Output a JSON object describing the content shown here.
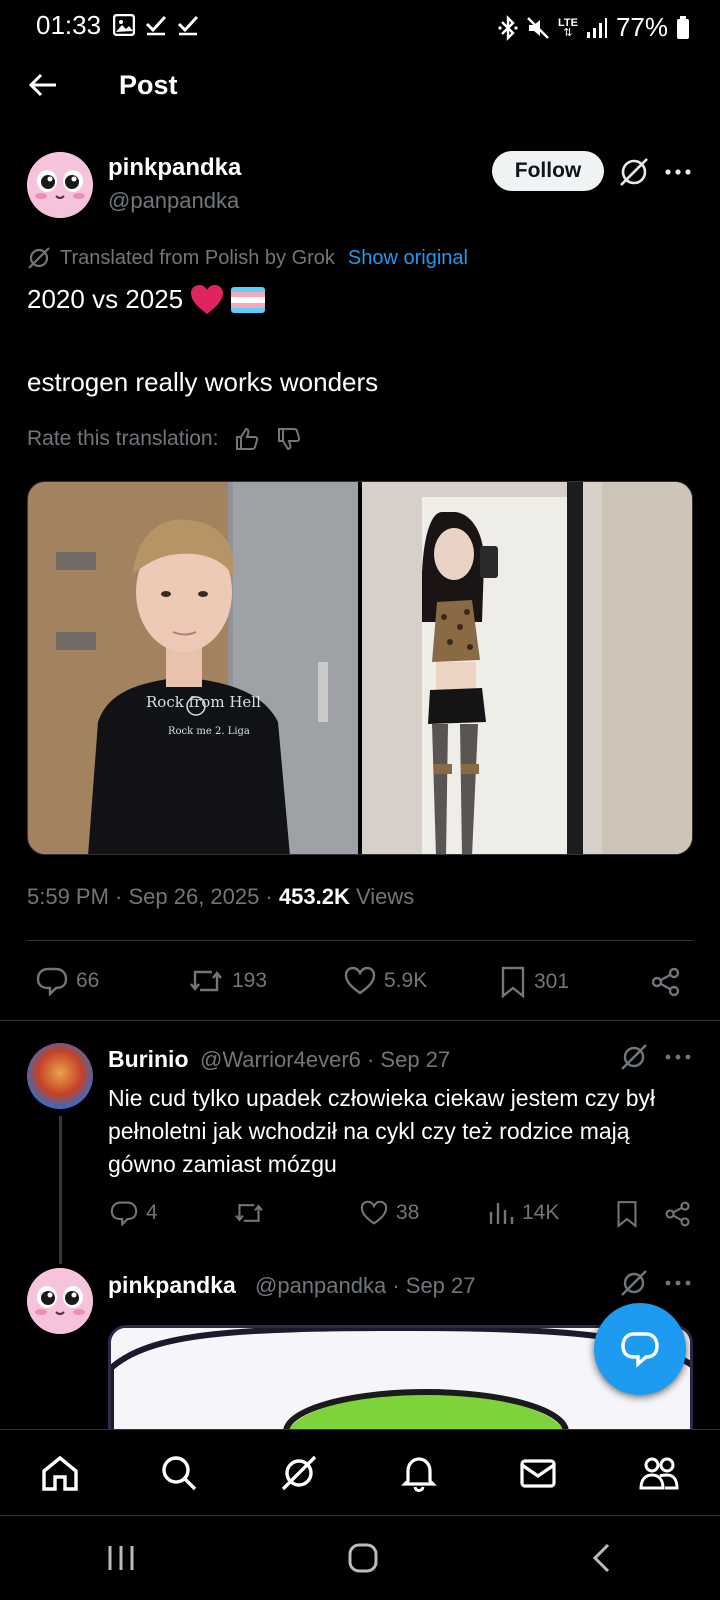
{
  "status_bar": {
    "time": "01:33",
    "battery": "77%",
    "icons_left": [
      "gallery-icon",
      "check-icon",
      "check-icon"
    ],
    "icons_right": [
      "bluetooth-icon",
      "mute-icon",
      "lte-icon",
      "signal-icon",
      "battery-icon"
    ],
    "lte_label": "LTE"
  },
  "header": {
    "title": "Post"
  },
  "post": {
    "author_name": "pinkpandka",
    "author_handle": "@panpandka",
    "follow_label": "Follow",
    "translation_note": "Translated from Polish by Grok",
    "show_original": "Show original",
    "text_line1": "2020 vs 2025",
    "text_line2": "estrogen really works wonders",
    "rate_label": "Rate this translation:",
    "time": "5:59 PM · Sep 26, 2025 · ",
    "views_count": "453.2K",
    "views_label": " Views",
    "shirt_text": "Rock from Hell",
    "shirt_subtext": "Rock me 2. Liga",
    "stats": {
      "replies": "66",
      "reposts": "193",
      "likes": "5.9K",
      "bookmarks": "301"
    }
  },
  "reply": {
    "author_name": "Burinio",
    "meta": "@Warrior4ever6 · Sep 27",
    "text": "Nie cud tylko upadek człowieka ciekaw jestem czy był pełnoletni jak wchodził na cykl czy też rodzice mają gówno zamiast mózgu",
    "stats": {
      "replies": "4",
      "likes": "38",
      "views": "14K"
    }
  },
  "reply2": {
    "author_name": "pinkpandka",
    "meta": "@panpandka · Sep 27"
  },
  "colors": {
    "accent": "#1d9bf0",
    "muted": "#71767b",
    "border": "#2f3336",
    "like_heart": "#e0245e"
  }
}
